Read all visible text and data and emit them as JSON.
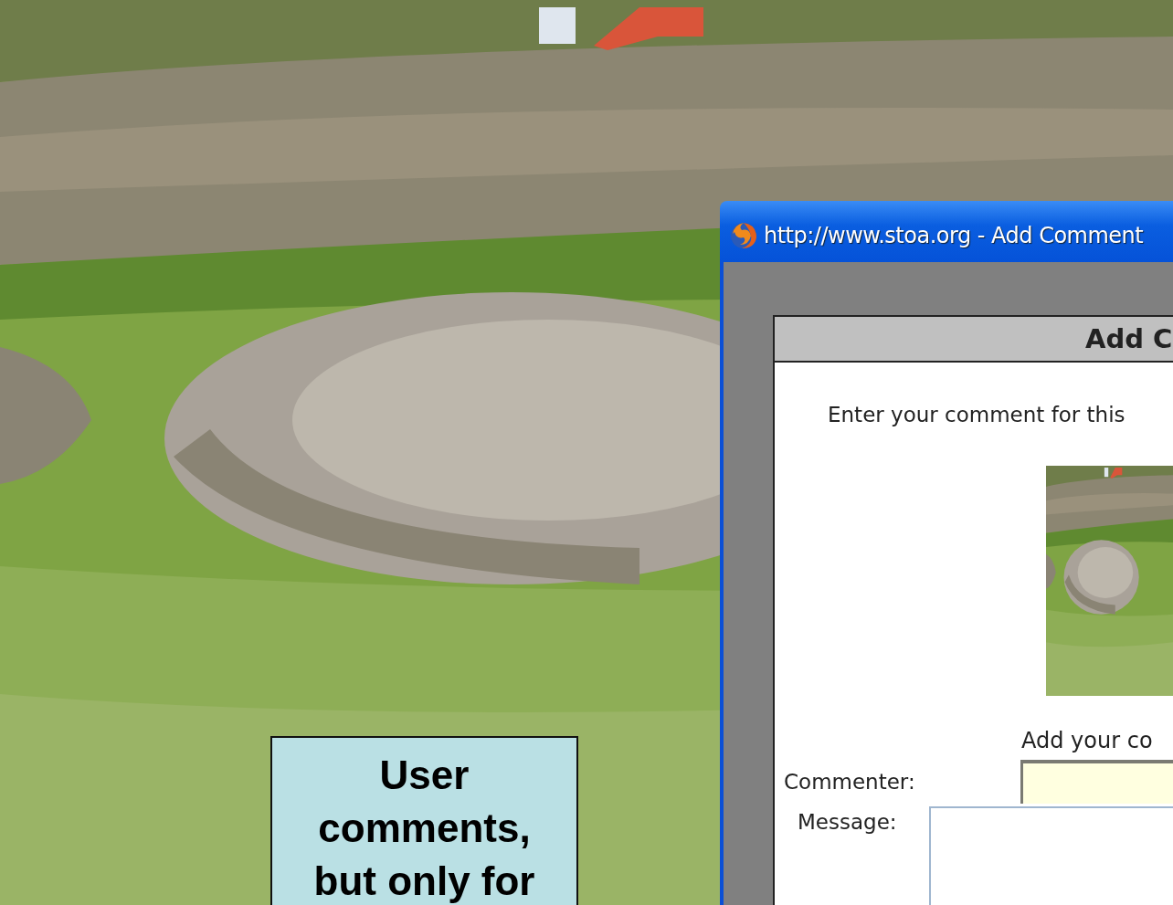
{
  "window": {
    "title": "http://www.stoa.org - Add Comment"
  },
  "page": {
    "heading": "Add C",
    "intro": "Enter your comment for this",
    "form_caption": "Add your co",
    "fields": [
      {
        "label": "Commenter:",
        "kind": "text"
      },
      {
        "label": "Message:",
        "kind": "textarea"
      }
    ]
  },
  "callout": {
    "text": "User comments, but only for"
  }
}
